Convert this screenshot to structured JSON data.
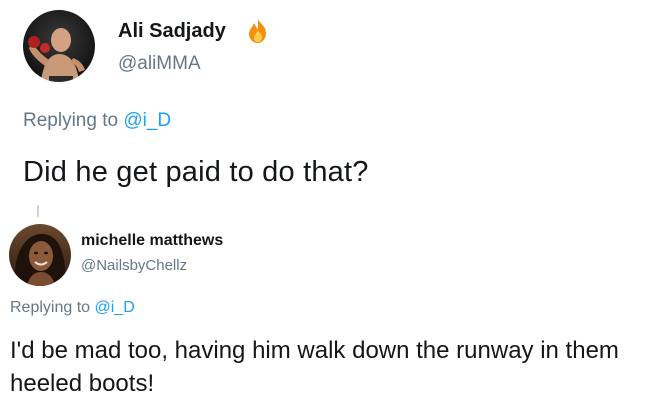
{
  "tweets": [
    {
      "display_name": "Ali Sadjady",
      "badge_icon": "fire-emoji",
      "handle": "@aliMMA",
      "replying_prefix": "Replying to",
      "replying_to": "@i_D",
      "text": "Did he get paid to do that?"
    },
    {
      "display_name": "michelle matthews",
      "handle": "@NailsbyChellz",
      "replying_prefix": "Replying to",
      "replying_to": "@i_D",
      "text": "I'd be mad too, having him walk down the runway in them heeled boots!"
    }
  ],
  "colors": {
    "text": "#14171a",
    "secondary": "#657786",
    "link": "#1da1f2",
    "thread_line": "#ccd6dd"
  }
}
